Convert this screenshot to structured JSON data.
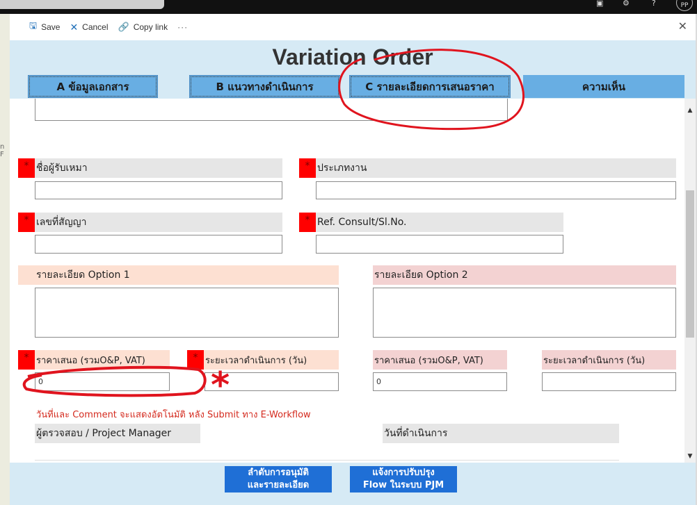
{
  "window": {
    "avatar_initials": "PP",
    "bg_fragment": "n F"
  },
  "toolbar": {
    "save_label": "Save",
    "cancel_label": "Cancel",
    "copy_link_label": "Copy link",
    "more_label": "···",
    "close_label": "✕"
  },
  "form": {
    "title": "Variation Order",
    "tabs": [
      {
        "label": "A ข้อมูลเอกสาร"
      },
      {
        "label": "B แนวทางดำเนินการ"
      },
      {
        "label": "C รายละเอียดการเสนอราคา"
      },
      {
        "label": "ความเห็น"
      }
    ],
    "required_mark": "*",
    "fields": {
      "contractor_name": {
        "label": "ชื่อผู้รับเหมา",
        "value": ""
      },
      "work_type": {
        "label": "ประเภทงาน",
        "value": ""
      },
      "contract_no": {
        "label": "เลขที่สัญญา",
        "value": ""
      },
      "ref_consult": {
        "label": "Ref. Consult/Sl.No.",
        "value": ""
      },
      "option1_detail": {
        "label": "รายละเอียด Option 1",
        "value": ""
      },
      "option2_detail": {
        "label": "รายละเอียด Option 2",
        "value": ""
      },
      "option1_price": {
        "label": "ราคาเสนอ (รวมO&P, VAT)",
        "value": "0"
      },
      "option1_duration": {
        "label": "ระยะเวลาดำเนินการ (วัน)",
        "value": ""
      },
      "option2_price": {
        "label": "ราคาเสนอ (รวมO&P, VAT)",
        "value": "0"
      },
      "option2_duration": {
        "label": "ระยะเวลาดำเนินการ (วัน)",
        "value": ""
      }
    },
    "note": "วันที่และ Comment จะแสดงอัตโนมัติ หลัง Submit ทาง E-Workflow",
    "reviewer_label": "ผู้ตรวจสอบ / Project Manager",
    "operation_date_label": "วันที่ดำเนินการ"
  },
  "footer": {
    "approval_button": {
      "line1": "ลำดับการอนุมัติ",
      "line2": "และรายละเอียด"
    },
    "notify_button": {
      "line1": "แจ้งการปรับปรุง",
      "line2": "Flow ในระบบ PJM"
    }
  },
  "annotations": {
    "color": "#e0141e",
    "asterisk": "*"
  },
  "colors": {
    "title_band": "#d6eaf5",
    "tab": "#68aee3",
    "required": "#ff0000",
    "peach_label": "#fde0d2",
    "pink_label": "#f3d2d2",
    "footer_button": "#1f6fd6",
    "note_text": "#d42a1e"
  }
}
